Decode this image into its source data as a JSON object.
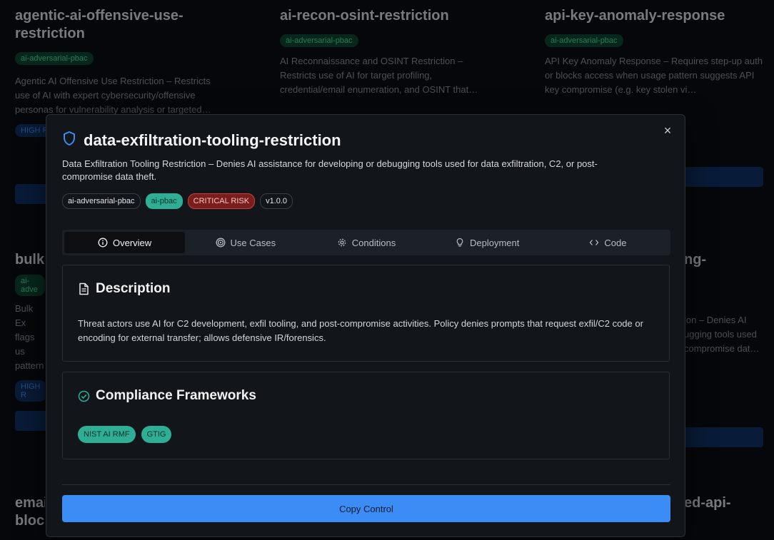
{
  "background_cards": [
    {
      "title": "agentic-ai-offensive-use-restriction",
      "tag": "ai-adversarial-pbac",
      "desc": "Agentic AI Offensive Use Restriction – Restricts use of AI with expert cybersecurity/offensive personas for vulnerability analysis or targeted…",
      "risk": "HIGH R"
    },
    {
      "title": "ai-recon-osint-restriction",
      "tag": "ai-adversarial-pbac",
      "desc": "AI Reconnaissance and OSINT Restriction – Restricts use of AI for target profiling, credential/email enumeration, and OSINT that…"
    },
    {
      "title": "api-key-anomaly-response",
      "tag": "ai-adversarial-pbac",
      "desc": "API Key Anomaly Response – Requires step-up auth or blocks access when usage pattern suggests API key compromise (e.g. key stolen vi…"
    },
    {
      "title": "bulk-",
      "tag": "ai-adve",
      "desc": "Bulk Ex flags us pattern",
      "risk": "HIGH R"
    },
    {
      "title": "ng-",
      "desc": "ion – Denies AI ugging tools used compromise dat…"
    },
    {
      "title": "emai block",
      "tag": ""
    },
    {
      "title": "ed-api-"
    }
  ],
  "modal": {
    "title": "data-exfiltration-tooling-restriction",
    "description": "Data Exfiltration Tooling Restriction – Denies AI assistance for developing or debugging tools used for data exfiltration, C2, or post-compromise data theft.",
    "badges": {
      "category": "ai-adversarial-pbac",
      "type": "ai-pbac",
      "risk": "CRITICAL RISK",
      "version": "v1.0.0"
    },
    "close_label": "×",
    "tabs": [
      "Overview",
      "Use Cases",
      "Conditions",
      "Deployment",
      "Code"
    ],
    "active_tab": "Overview",
    "description_section": {
      "title": "Description",
      "text": "Threat actors use AI for C2 development, exfil tooling, and post-compromise activities. Policy denies prompts that request exfil/C2 code or encoding for external transfer; allows defensive IR/forensics."
    },
    "compliance_section": {
      "title": "Compliance Frameworks",
      "frameworks": [
        "NIST AI RMF",
        "GTIG"
      ]
    },
    "copy_button": "Copy Control"
  },
  "colors": {
    "accent": "#3b8df5",
    "teal": "#2fae96",
    "critical": "#7c1d1d",
    "background": "#0a0c10"
  }
}
